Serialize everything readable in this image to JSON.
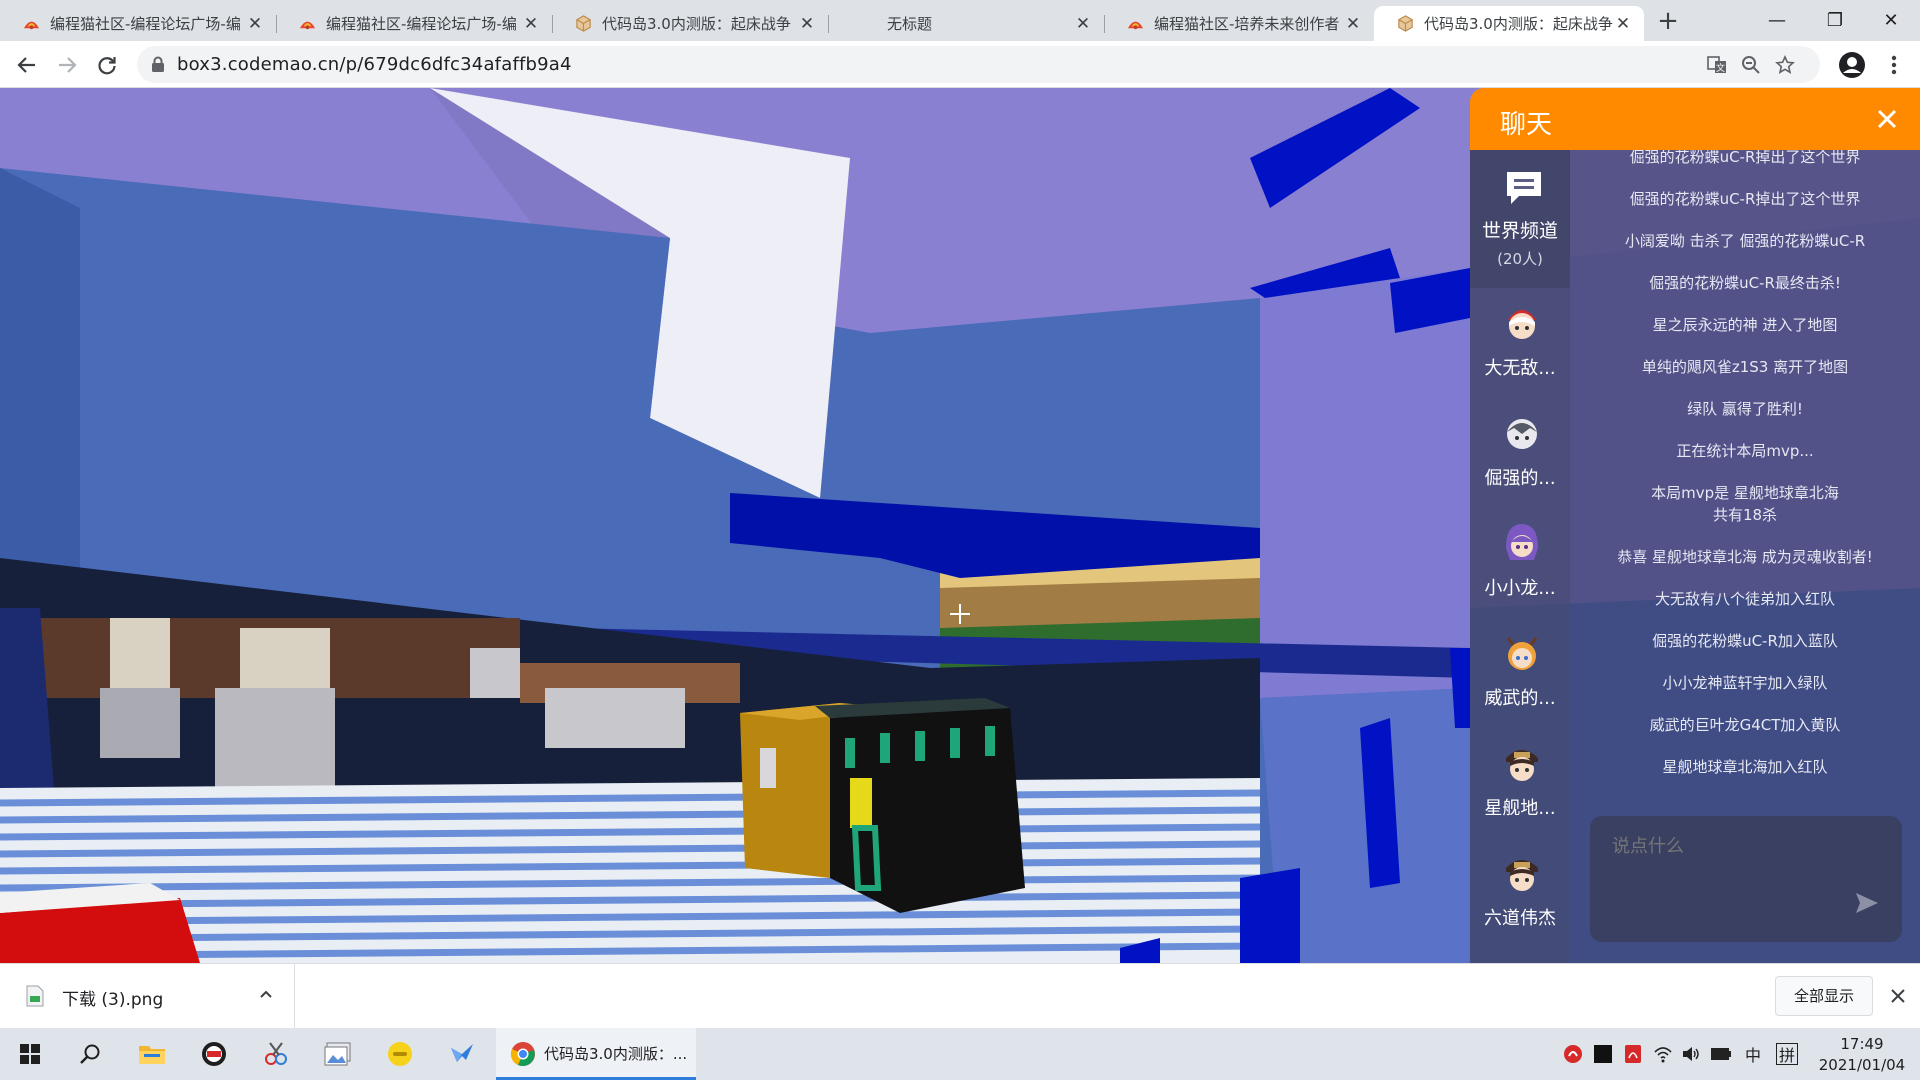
{
  "browser": {
    "tabs": [
      {
        "title": "编程猫社区-编程论坛广场-编",
        "favicon": "codemao-cat-icon"
      },
      {
        "title": "编程猫社区-编程论坛广场-编",
        "favicon": "codemao-cat-icon"
      },
      {
        "title": "代码岛3.0内测版：起床战争",
        "favicon": "box3-cube-icon"
      },
      {
        "title": "无标题",
        "favicon": ""
      },
      {
        "title": "编程猫社区-培养未来创作者",
        "favicon": "codemao-cat-icon"
      },
      {
        "title": "代码岛3.0内测版：起床战争",
        "favicon": "box3-cube-icon",
        "active": true
      }
    ],
    "url": "box3.codemao.cn/p/679dc6dfc34afaffb9a4"
  },
  "chat": {
    "title": "聊天",
    "world_channel": {
      "name": "世界频道",
      "count": "(20人)"
    },
    "players": [
      {
        "name": "大无敌..."
      },
      {
        "name": "倔强的..."
      },
      {
        "name": "小小龙..."
      },
      {
        "name": "威武的..."
      },
      {
        "name": "星舰地..."
      },
      {
        "name": "六道伟杰"
      }
    ],
    "messages": [
      "倔强的花粉蝶uC-R掉出了这个世界",
      "倔强的花粉蝶uC-R掉出了这个世界",
      "小阔爱呦 击杀了 倔强的花粉蝶uC-R",
      "倔强的花粉蝶uC-R最终击杀!",
      "星之辰永远的神 进入了地图",
      "单纯的飓风雀z1S3 离开了地图",
      "绿队 赢得了胜利!",
      "正在统计本局mvp...",
      "本局mvp是 星舰地球章北海",
      "共有18杀",
      "恭喜 星舰地球章北海 成为灵魂收割者!",
      "大无敌有八个徒弟加入红队",
      "倔强的花粉蝶uC-R加入蓝队",
      "小小龙神蓝轩宇加入绿队",
      "威武的巨叶龙G4CT加入黄队",
      "星舰地球章北海加入红队"
    ],
    "input_placeholder": "说点什么"
  },
  "downloads": {
    "file": "下载 (3).png",
    "show_all": "全部显示"
  },
  "taskbar": {
    "active_window": "代码岛3.0内测版：...",
    "ime_lang": "中",
    "ime_mode": "拼",
    "time": "17:49",
    "date": "2021/01/04"
  },
  "colors": {
    "chat_header": "#ff8a00",
    "sky": "#8a7fd0",
    "wall": "#4a6bb8"
  }
}
